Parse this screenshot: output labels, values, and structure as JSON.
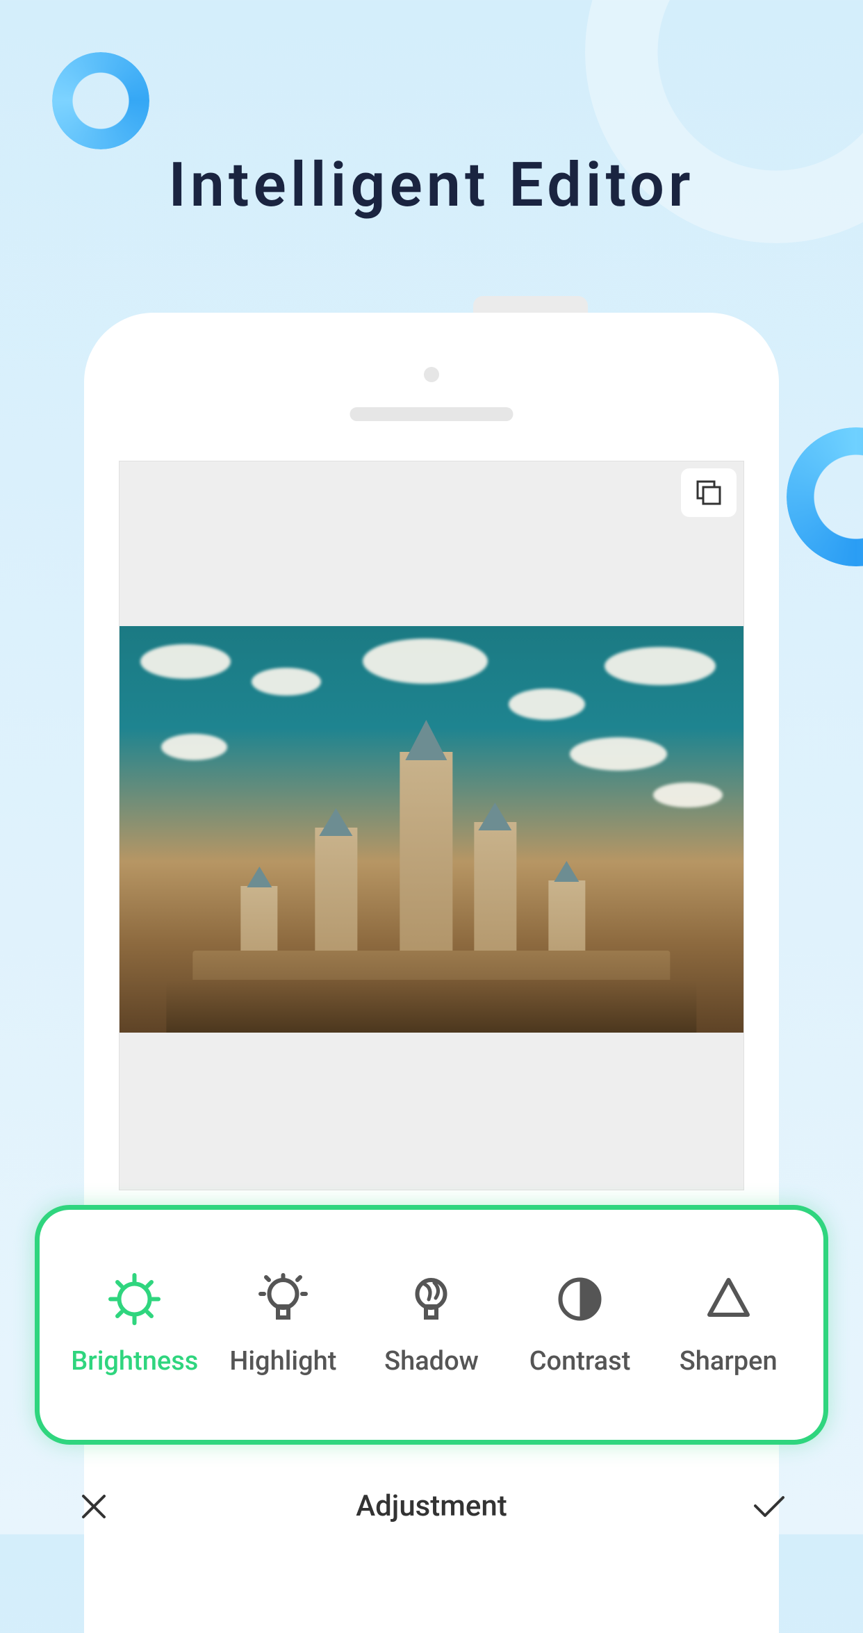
{
  "page_title": "Intelligent   Editor",
  "tools": [
    {
      "label": "Brightness",
      "icon": "brightness-icon",
      "active": true
    },
    {
      "label": "Highlight",
      "icon": "highlight-icon",
      "active": false
    },
    {
      "label": "Shadow",
      "icon": "shadow-icon",
      "active": false
    },
    {
      "label": "Contrast",
      "icon": "contrast-icon",
      "active": false
    },
    {
      "label": "Sharpen",
      "icon": "sharpen-icon",
      "active": false
    }
  ],
  "action_bar": {
    "title": "Adjustment"
  },
  "colors": {
    "accent": "#2fd57e",
    "title": "#1a2440",
    "tool_default": "#555555"
  }
}
